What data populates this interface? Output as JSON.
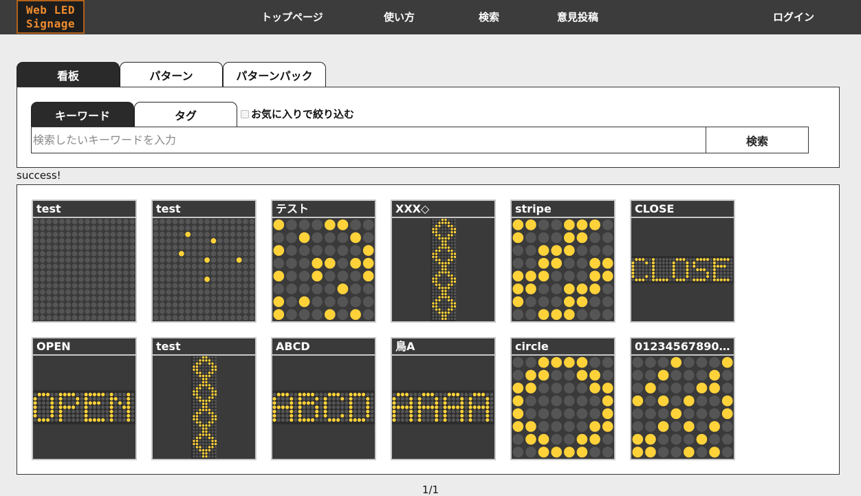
{
  "header": {
    "logo_lines": [
      "Web LED",
      "Signage"
    ],
    "nav": [
      "トップページ",
      "使い方",
      "検索",
      "意見投稿"
    ],
    "login": "ログイン"
  },
  "main_tabs": [
    "看板",
    "パターン",
    "パターンパック"
  ],
  "search": {
    "sub_tabs": [
      "キーワード",
      "タグ"
    ],
    "favorite_filter_label": "お気に入りで絞り込む",
    "favorite_filter_checked": false,
    "placeholder": "検索したいキーワードを入力",
    "value": "",
    "button": "検索"
  },
  "status": "success!",
  "results": [
    {
      "title": "test",
      "preview": "blank"
    },
    {
      "title": "test",
      "preview": "dots"
    },
    {
      "title": "テスト",
      "preview": "katakana"
    },
    {
      "title": "XXX◇",
      "preview": "column-diamonds"
    },
    {
      "title": "stripe",
      "preview": "stripe"
    },
    {
      "title": "CLOSE",
      "preview": "text",
      "text": "CLOSE"
    },
    {
      "title": "OPEN",
      "preview": "text",
      "text": "OPEN"
    },
    {
      "title": "test",
      "preview": "column-rings"
    },
    {
      "title": "ABCD",
      "preview": "text",
      "text": "ABCD"
    },
    {
      "title": "鳥A",
      "preview": "text",
      "text": "AAAA"
    },
    {
      "title": "circle",
      "preview": "circle"
    },
    {
      "title": "01234567890…",
      "preview": "stripe-sparse"
    }
  ],
  "pagination": "1/1",
  "colors": {
    "header_bg": "#3c3c3c",
    "logo_text": "#f08c2e",
    "led_on": "#ffd23a",
    "led_off": "#555555",
    "board_bg": "#3a3a3a"
  }
}
